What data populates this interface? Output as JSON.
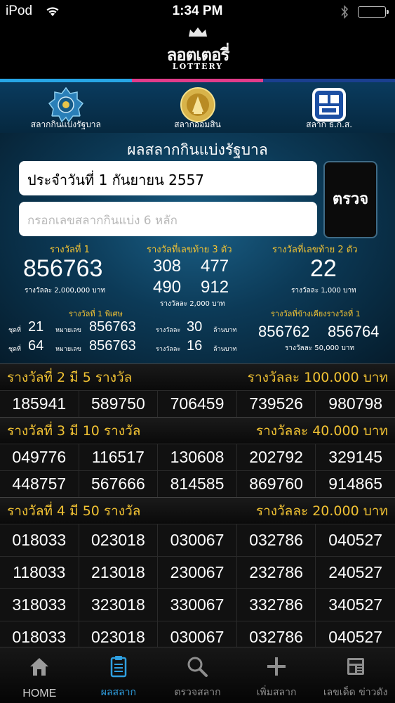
{
  "status": {
    "carrier": "iPod",
    "time": "1:34 PM"
  },
  "header": {
    "logo_th": "ลอตเตอรี่",
    "logo_en": "LOTTERY"
  },
  "stripe_colors": [
    "#27a6e6",
    "#e23c8a",
    "#1a3f8f"
  ],
  "top_tabs": [
    {
      "label": "สลากกินแบ่งรัฐบาล",
      "icon": "government-lottery-seal-icon"
    },
    {
      "label": "สลากออมสิน",
      "icon": "gsb-savings-seal-icon"
    },
    {
      "label": "สลาก ธ.ก.ส.",
      "icon": "baac-logo-icon"
    }
  ],
  "panel": {
    "title": "ผลสลากกินแบ่งรัฐบาล",
    "date": "ประจำวันที่ 1 กันยายน 2557",
    "search_placeholder": "กรอกเลขสลากกินแบ่ง 6 หลัก",
    "check_label": "ตรวจ",
    "first": {
      "label": "รางวัลที่ 1",
      "number": "856763",
      "amount": "รางวัลละ 2,000,000 บาท"
    },
    "last3": {
      "label": "รางวัลที่เลขท้าย 3 ตัว",
      "numbers": [
        "308",
        "477",
        "490",
        "912"
      ],
      "amount": "รางวัลละ 2,000 บาท"
    },
    "last2": {
      "label": "รางวัลที่เลขท้าย 2 ตัว",
      "number": "22",
      "amount": "รางวัลละ 1,000 บาท"
    },
    "special": {
      "label": "รางวัลที่ 1 พิเศษ",
      "rows": [
        {
          "set_label": "ชุดที่",
          "set": "21",
          "num_label": "หมายเลข",
          "number": "856763",
          "amt_label": "รางวัลละ",
          "amount": "30",
          "unit": "ล้านบาท"
        },
        {
          "set_label": "ชุดที่",
          "set": "64",
          "num_label": "หมายเลข",
          "number": "856763",
          "amt_label": "รางวัลละ",
          "amount": "16",
          "unit": "ล้านบาท"
        }
      ]
    },
    "near": {
      "label": "รางวัลที่ข้างเคียงรางวัลที่ 1",
      "numbers": [
        "856762",
        "856764"
      ],
      "amount": "รางวัลละ 50,000 บาท"
    }
  },
  "sections": [
    {
      "title": "รางวัลที่ 2 มี 5 รางวัล",
      "amount": "รางวัลละ 100.000 บาท",
      "rows": [
        [
          "185941",
          "589750",
          "706459",
          "739526",
          "980798"
        ]
      ]
    },
    {
      "title": "รางวัลที่ 3 มี 10 รางวัล",
      "amount": "รางวัลละ 40.000 บาท",
      "rows": [
        [
          "049776",
          "116517",
          "130608",
          "202792",
          "329145"
        ],
        [
          "448757",
          "567666",
          "814585",
          "869760",
          "914865"
        ]
      ]
    },
    {
      "title": "รางวัลที่ 4 มี 50 รางวัล",
      "amount": "รางวัลละ 20.000 บาท",
      "rows": [
        [
          "018033",
          "023018",
          "030067",
          "032786",
          "040527"
        ],
        [
          "118033",
          "213018",
          "230067",
          "232786",
          "240527"
        ],
        [
          "318033",
          "323018",
          "330067",
          "332786",
          "340527"
        ],
        [
          "018033",
          "023018",
          "030067",
          "032786",
          "040527"
        ]
      ]
    }
  ],
  "tabbar": [
    {
      "label": "HOME",
      "icon": "home-icon"
    },
    {
      "label": "ผลสลาก",
      "icon": "clipboard-icon"
    },
    {
      "label": "ตรวจสลาก",
      "icon": "magnifier-icon"
    },
    {
      "label": "เพิ่มสลาก",
      "icon": "plus-icon"
    },
    {
      "label": "เลขเด็ด ข่าวดัง",
      "icon": "news-icon"
    }
  ]
}
